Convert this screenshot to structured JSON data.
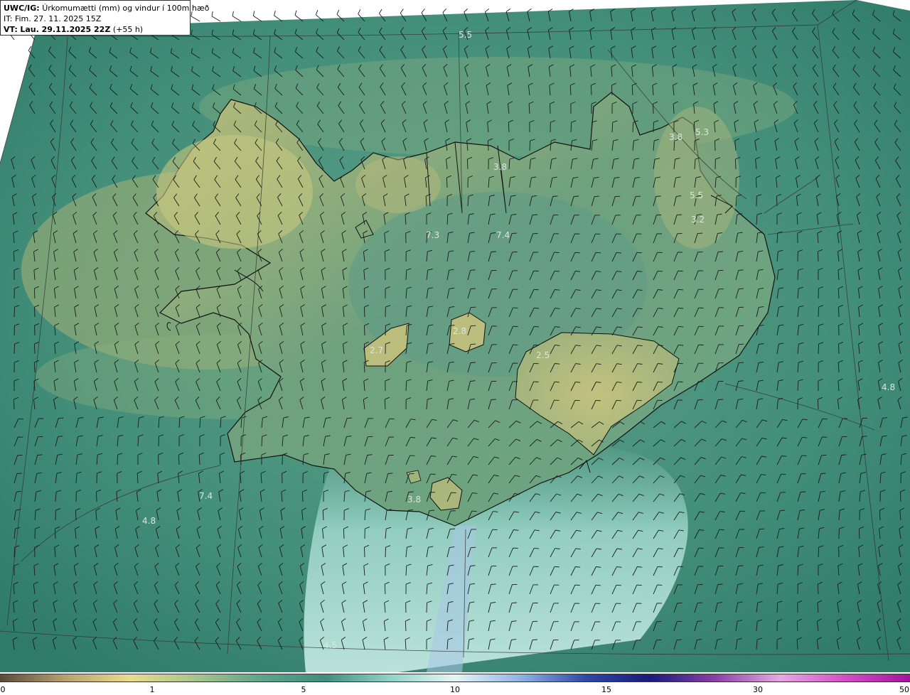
{
  "header": {
    "model_label": "UWC/IG:",
    "title": "Úrkomumætti (mm) og vindur í 100m hæð",
    "it_label": "IT:",
    "it_value": "Fim. 27. 11. 2025 15Z",
    "vt_label": "VT:",
    "vt_value": "Lau. 29.11.2025 22Z",
    "vt_offset": "(+55 h)"
  },
  "colors": {
    "ocean": "#3f8f7c",
    "land_low": "#c6c77a",
    "land_mid": "#7fae83",
    "coastline": "#111111",
    "grid": "#3a3a3a",
    "label": "#d9e6df"
  },
  "value_labels": [
    {
      "text": "5.5",
      "id": "n-ocean"
    },
    {
      "text": "5.3",
      "id": "ne-coast"
    },
    {
      "text": "3.8",
      "id": "ne-fjord"
    },
    {
      "text": "3.8",
      "id": "north-fjord"
    },
    {
      "text": "5.5",
      "id": "east-north"
    },
    {
      "text": "3.2",
      "id": "east-highland"
    },
    {
      "text": "7.3",
      "id": "north-central-a"
    },
    {
      "text": "7.4",
      "id": "north-central-b"
    },
    {
      "text": "2.8",
      "id": "hofsjokull"
    },
    {
      "text": "2.7",
      "id": "langjokull"
    },
    {
      "text": "2.5",
      "id": "vatnajokull"
    },
    {
      "text": "4.8",
      "id": "se-ocean"
    },
    {
      "text": "7.4",
      "id": "sw-ocean-a"
    },
    {
      "text": "4.8",
      "id": "sw-ocean-b"
    },
    {
      "text": "3.8",
      "id": "myrdalsjokull"
    },
    {
      "text": "4.5",
      "id": "s-ocean"
    }
  ],
  "colorbar": {
    "ticks": [
      "0",
      "1",
      "5",
      "10",
      "15",
      "30",
      "50"
    ],
    "stops": [
      "#5a4a3a",
      "#b8a071",
      "#e8dc8e",
      "#a9c48c",
      "#5ea58a",
      "#3f8f7c",
      "#8fd3c6",
      "#e6f5f4",
      "#8fb4e4",
      "#2d4aa8",
      "#1a1a7a",
      "#8a3fa6",
      "#e6a8e0",
      "#d24fc6",
      "#a2149a"
    ]
  }
}
